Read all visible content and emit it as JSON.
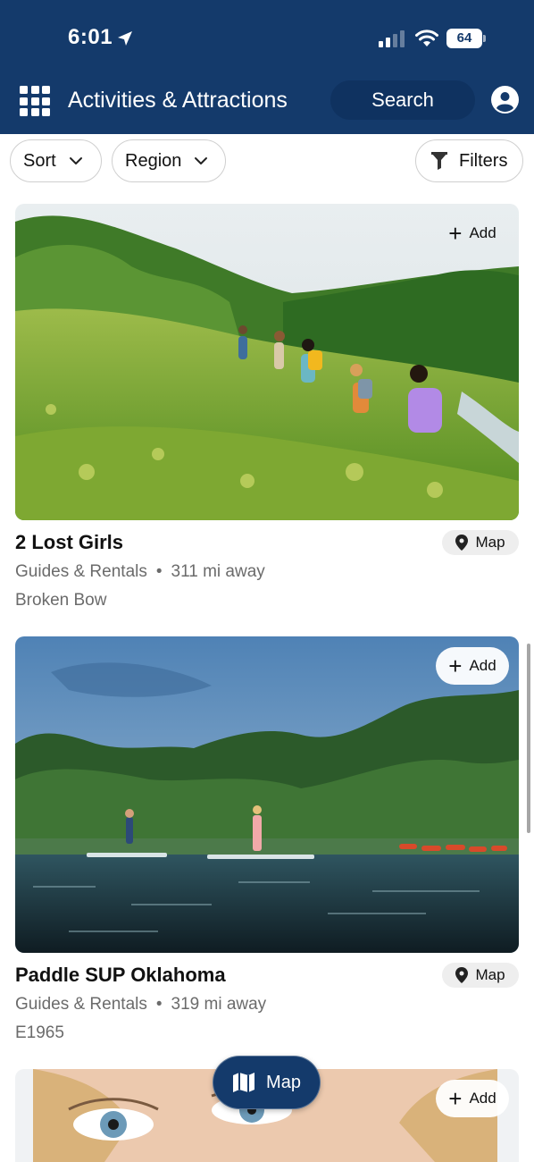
{
  "status_bar": {
    "time": "6:01",
    "battery": "64"
  },
  "header": {
    "title": "Activities & Attractions",
    "search_label": "Search"
  },
  "filters": {
    "sort_label": "Sort",
    "region_label": "Region",
    "filters_label": "Filters"
  },
  "cards": [
    {
      "add_label": "Add",
      "title": "2 Lost Girls",
      "map_label": "Map",
      "category": "Guides & Rentals",
      "distance": "311 mi away",
      "location": "Broken Bow"
    },
    {
      "add_label": "Add",
      "title": "Paddle SUP Oklahoma",
      "map_label": "Map",
      "category": "Guides & Rentals",
      "distance": "319 mi away",
      "location": "E1965"
    },
    {
      "add_label": "Add"
    }
  ],
  "floating": {
    "map_label": "Map"
  },
  "colors": {
    "header_bg": "#143a6b",
    "search_bg": "#0f3260",
    "text_secondary": "#6b6b6b"
  },
  "icons": [
    "location-arrow-icon",
    "signal-icon",
    "wifi-icon",
    "battery-icon",
    "grid-menu-icon",
    "profile-icon",
    "chevron-down-icon",
    "funnel-icon",
    "plus-icon",
    "map-pin-icon",
    "map-icon"
  ]
}
